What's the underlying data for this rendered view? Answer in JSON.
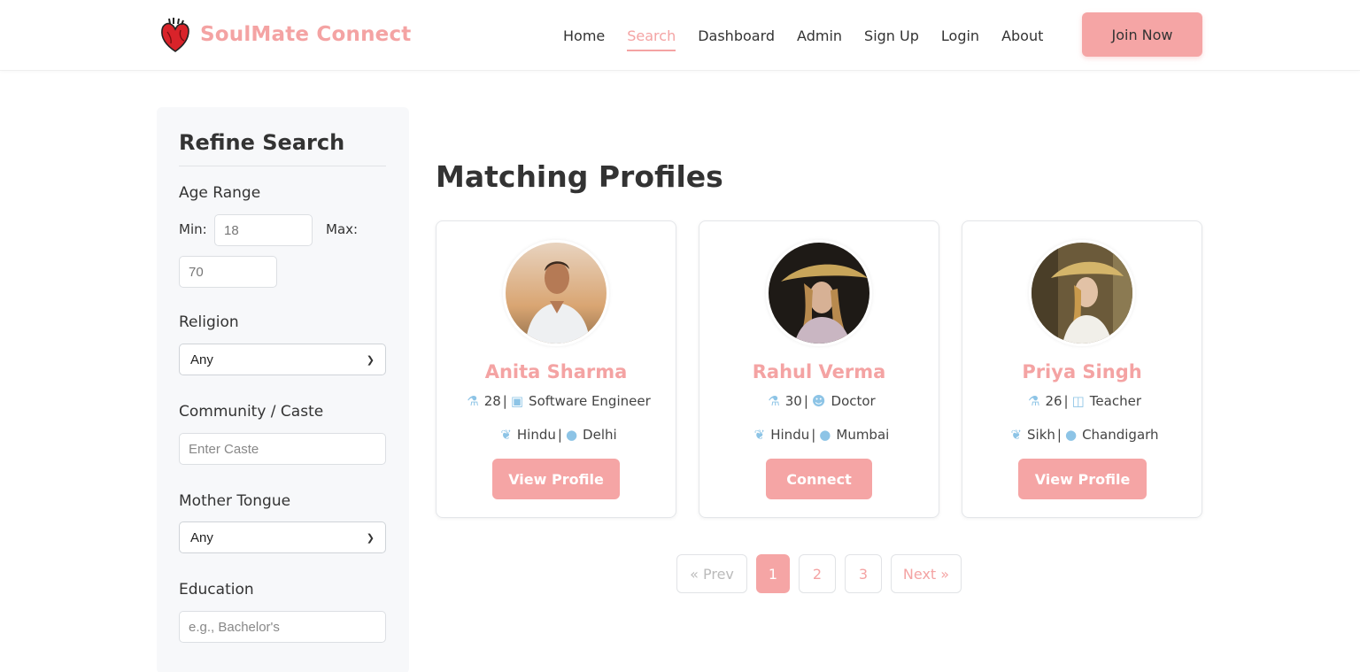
{
  "header": {
    "brand": "SoulMate Connect",
    "nav": [
      "Home",
      "Search",
      "Dashboard",
      "Admin",
      "Sign Up",
      "Login",
      "About"
    ],
    "active_nav": "Search",
    "join_label": "Join Now"
  },
  "sidebar": {
    "title": "Refine Search",
    "age_range": {
      "label": "Age Range",
      "min_label": "Min:",
      "min_value": "18",
      "max_label": "Max:",
      "max_value": "70"
    },
    "religion": {
      "label": "Religion",
      "value": "Any"
    },
    "community": {
      "label": "Community / Caste",
      "placeholder": "Enter Caste"
    },
    "mother_tongue": {
      "label": "Mother Tongue",
      "value": "Any"
    },
    "education": {
      "label": "Education",
      "placeholder": "e.g., Bachelor's"
    }
  },
  "main": {
    "title": "Matching Profiles",
    "profiles": [
      {
        "name": "Anita Sharma",
        "age": "28",
        "profession": "Software Engineer",
        "religion": "Hindu",
        "city": "Delhi",
        "action": "View Profile",
        "profession_icon": "briefcase-icon"
      },
      {
        "name": "Rahul Verma",
        "age": "30",
        "profession": "Doctor",
        "religion": "Hindu",
        "city": "Mumbai",
        "action": "Connect",
        "profession_icon": "user-doctor-icon"
      },
      {
        "name": "Priya Singh",
        "age": "26",
        "profession": "Teacher",
        "religion": "Sikh",
        "city": "Chandigarh",
        "action": "View Profile",
        "profession_icon": "chalkboard-teacher-icon"
      }
    ]
  },
  "pagination": {
    "prev": "« Prev",
    "pages": [
      "1",
      "2",
      "3"
    ],
    "current": "1",
    "next": "Next »"
  },
  "colors": {
    "accent": "#f4a3a3",
    "icon": "#8dc4e6"
  }
}
